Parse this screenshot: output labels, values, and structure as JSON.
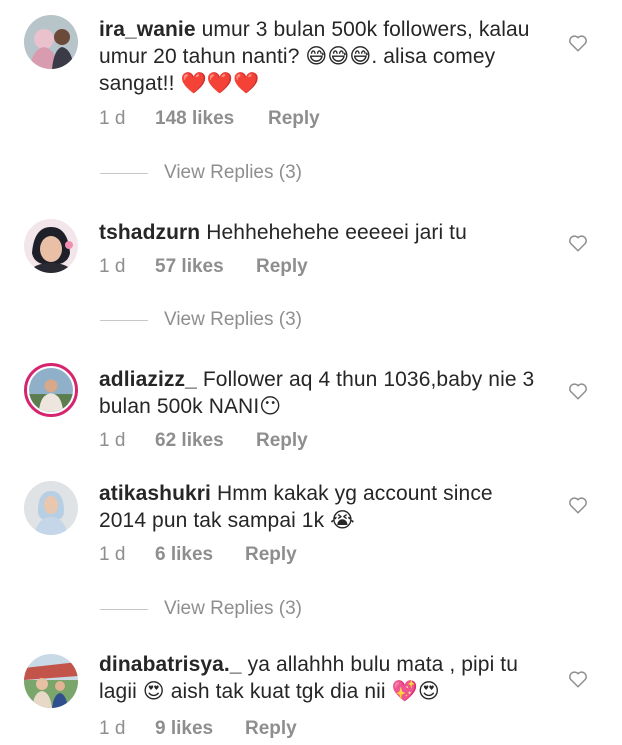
{
  "comments": [
    {
      "username": "ira_wanie",
      "text": "umur 3 bulan 500k followers, kalau umur 20 tahun nanti? 😅😅😅. alisa comey sangat!! ❤️❤️❤️",
      "time": "1 d",
      "likes": "148 likes",
      "reply": "Reply",
      "has_story": false,
      "avatar_icon": "avatar-photo"
    },
    {
      "username": "tshadzurn",
      "text": "Hehhehehehe eeeeei jari tu",
      "time": "1 d",
      "likes": "57 likes",
      "reply": "Reply",
      "has_story": false,
      "avatar_icon": "avatar-photo"
    },
    {
      "username": "adliazizz_",
      "text": "Follower aq 4 thun 1036,baby nie 3 bulan 500k NANI😶",
      "time": "1 d",
      "likes": "62 likes",
      "reply": "Reply",
      "has_story": true,
      "avatar_icon": "avatar-photo"
    },
    {
      "username": "atikashukri",
      "text": "Hmm kakak yg account since 2014 pun tak sampai 1k 😭",
      "time": "1 d",
      "likes": "6 likes",
      "reply": "Reply",
      "has_story": false,
      "avatar_icon": "avatar-photo"
    },
    {
      "username": "dinabatrisya._",
      "text": "ya allahhh bulu mata , pipi tu lagii 😍 aish tak kuat tgk dia nii 💖😍",
      "time": "1 d",
      "likes": "9 likes",
      "reply": "Reply",
      "has_story": false,
      "avatar_icon": "avatar-photo"
    }
  ],
  "view_replies": [
    "View Replies (3)",
    "View Replies (3)",
    "View Replies (3)"
  ],
  "colors": {
    "text": "#262626",
    "muted": "#8e8e8e",
    "story_ring": "#d6246e",
    "heart_red": "#ed1c24"
  },
  "icons": {
    "like": "heart-outline-icon"
  }
}
